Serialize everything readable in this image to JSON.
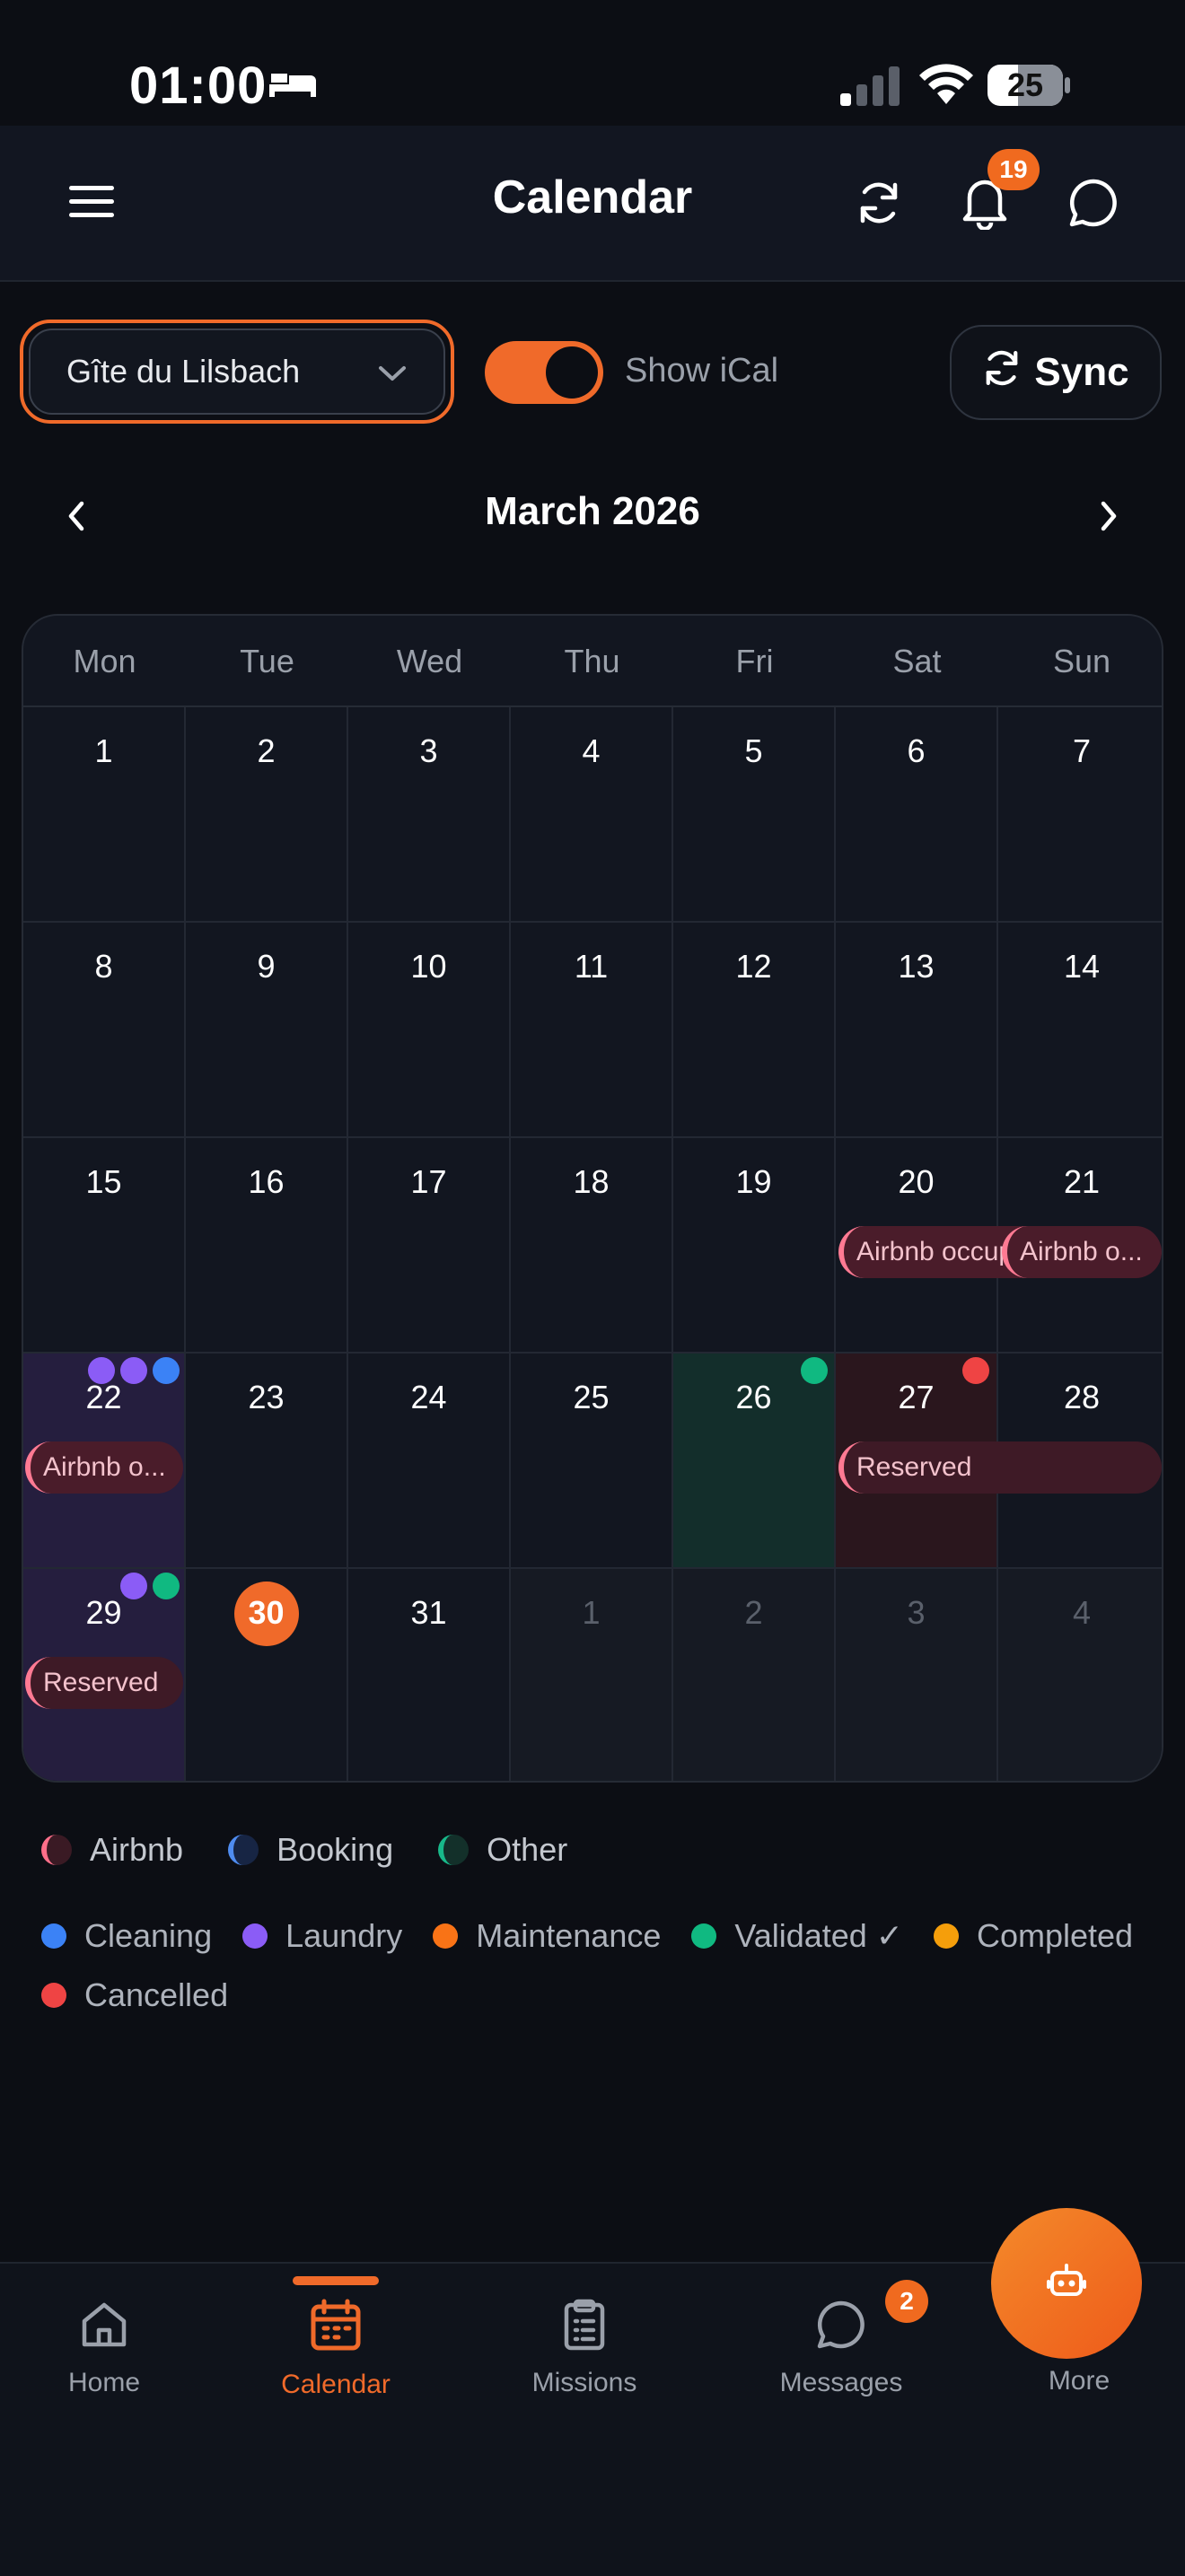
{
  "status_bar": {
    "time": "01:00",
    "battery": "25"
  },
  "header": {
    "title": "Calendar",
    "notification_count": "19"
  },
  "controls": {
    "property_select": "Gîte du Lilsbach",
    "toggle_label": "Show iCal",
    "toggle_on": true,
    "sync_label": "Sync"
  },
  "month_nav": {
    "label": "March 2026"
  },
  "calendar": {
    "weekdays": [
      "Mon",
      "Tue",
      "Wed",
      "Thu",
      "Fri",
      "Sat",
      "Sun"
    ],
    "weeks": [
      [
        "1",
        "2",
        "3",
        "4",
        "5",
        "6",
        "7"
      ],
      [
        "8",
        "9",
        "10",
        "11",
        "12",
        "13",
        "14"
      ],
      [
        "15",
        "16",
        "17",
        "18",
        "19",
        "20",
        "21"
      ],
      [
        "22",
        "23",
        "24",
        "25",
        "26",
        "27",
        "28"
      ],
      [
        "29",
        "30",
        "31",
        "1",
        "2",
        "3",
        "4"
      ]
    ],
    "today": "30",
    "events": {
      "sat20": "Airbnb occupied",
      "sun21": "Airbnb o...",
      "mon22": "Airbnb o...",
      "sat27": "Reserved",
      "mon29": "Reserved"
    }
  },
  "legend": {
    "sources": [
      {
        "label": "Airbnb",
        "color": "#ff6f8a"
      },
      {
        "label": "Booking",
        "color": "#4f8cf0"
      },
      {
        "label": "Other",
        "color": "#18b98a"
      }
    ],
    "statuses": [
      {
        "label": "Cleaning",
        "color": "#3b82f6"
      },
      {
        "label": "Laundry",
        "color": "#8b5cf6"
      },
      {
        "label": "Maintenance",
        "color": "#f97316"
      },
      {
        "label": "Validated ✓",
        "color": "#10b981"
      },
      {
        "label": "Completed",
        "color": "#f59e0b"
      },
      {
        "label": "Cancelled",
        "color": "#ef4444"
      }
    ]
  },
  "tabs": {
    "home": "Home",
    "calendar": "Calendar",
    "missions": "Missions",
    "messages": "Messages",
    "messages_badge": "2",
    "more": "More"
  },
  "colors": {
    "accent": "#f06a2a",
    "background": "#0c0e14"
  }
}
